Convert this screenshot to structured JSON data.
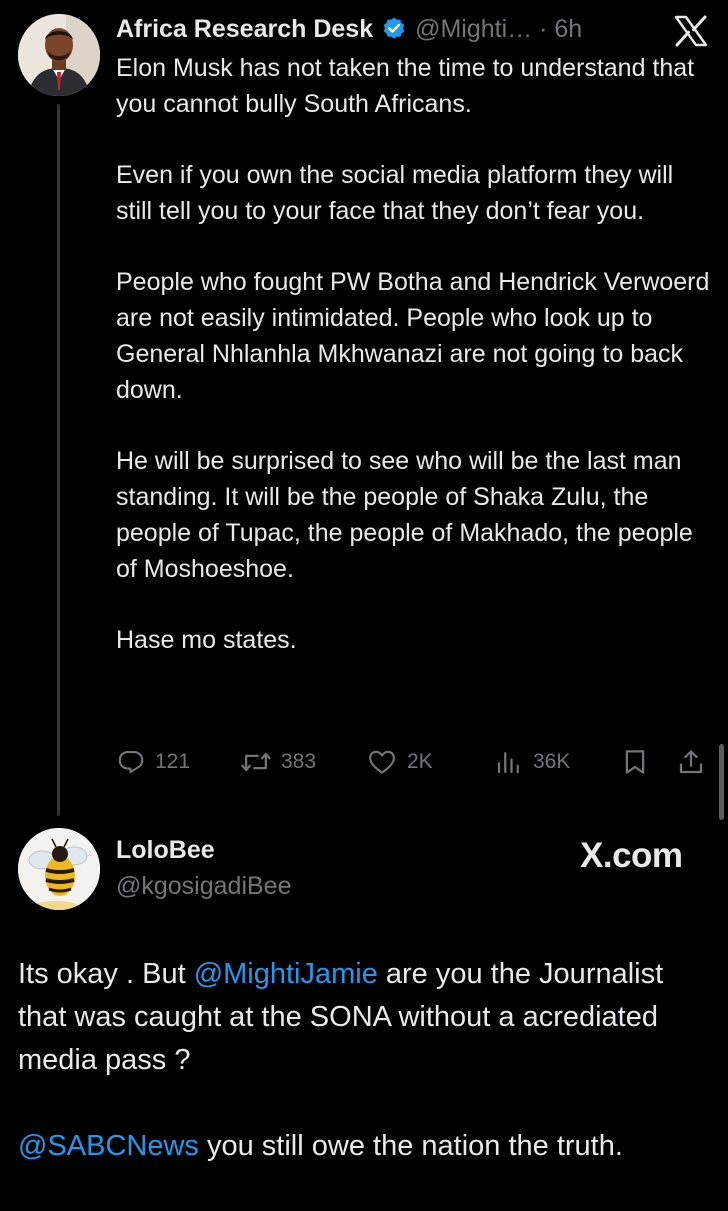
{
  "post": {
    "author_name": "Africa Research Desk",
    "handle_time": "@Mighti…  · 6h",
    "paragraphs": [
      "Elon Musk has not taken the time to understand that you cannot bully South Africans.",
      "Even if you own the social media platform they will still tell you to your face that they don’t fear you.",
      "People who fought PW Botha and Hendrick Verwoerd are not easily intimidated. People who look up to General Nhlanhla Mkhwanazi are not going to back down.",
      "He will be surprised to see who will be the last man standing. It will be the people of Shaka Zulu, the people of Tupac, the people of Makhado, the people of Moshoeshoe.",
      "Hase mo states."
    ],
    "actions": {
      "replies": "121",
      "reposts": "383",
      "likes": "2K",
      "views": "36K"
    }
  },
  "reply": {
    "author_name": "LoloBee",
    "handle": "@kgosigadiBee",
    "source_label": "X.com",
    "line1_before": "Its okay . But ",
    "line1_mention": "@MightiJamie",
    "line1_after": " are you the Journalist that was caught at the SONA without a acrediated media pass ?",
    "line2_mention": "@SABCNews",
    "line2_after": " you still owe the nation the truth."
  },
  "icons": {
    "verified_badge": "verified-badge-icon",
    "x_logo": "x-logo-icon",
    "reply": "reply-icon",
    "repost": "repost-icon",
    "like": "heart-icon",
    "views": "views-icon",
    "bookmark": "bookmark-icon",
    "share": "share-icon"
  },
  "colors": {
    "background": "#000000",
    "text": "#e7e9ea",
    "muted": "#71767b",
    "link": "#1d9bf0",
    "verified": "#1d9bf0"
  }
}
